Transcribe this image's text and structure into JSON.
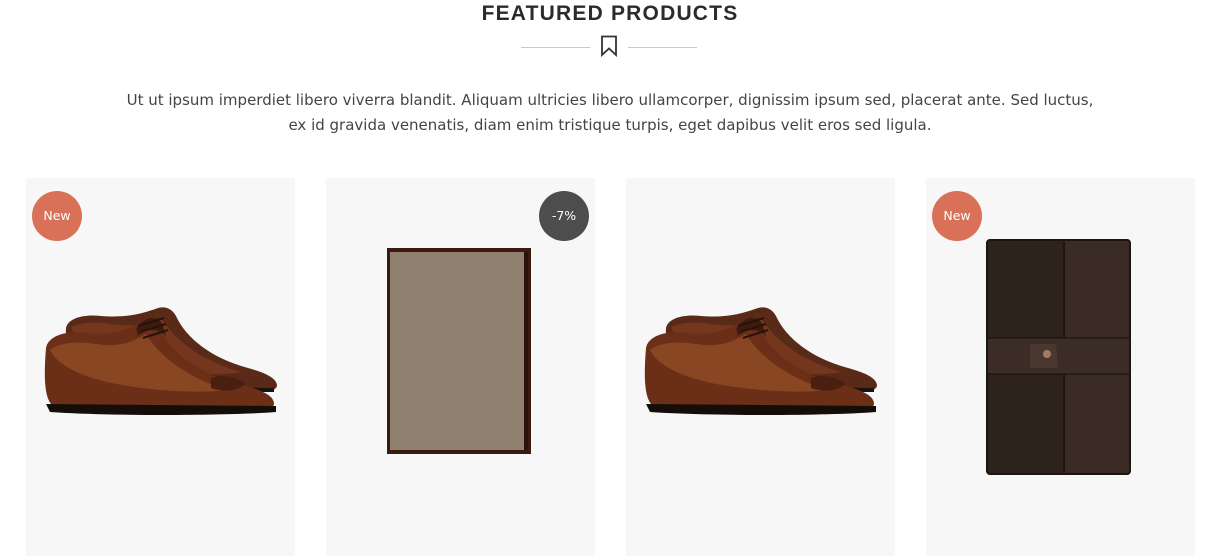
{
  "section": {
    "title": "FEATURED PRODUCTS",
    "description_line1": "Ut ut ipsum imperdiet libero viverra blandit. Aliquam ultricies libero ullamcorper, dignissim ipsum sed, placerat ante. Sed luctus,",
    "description_line2": "ex id gravida venenatis, diam enim tristique turpis, eget dapibus velit eros sed ligula.",
    "divider_icon": "bookmark-icon"
  },
  "products": [
    {
      "image": "brown-leather-oxford-shoes",
      "badge": "New",
      "badge_type": "new"
    },
    {
      "image": "brown-card-holder",
      "badge": "-7%",
      "badge_type": "sale"
    },
    {
      "image": "brown-leather-oxford-shoes",
      "badge": "",
      "badge_type": ""
    },
    {
      "image": "dark-leather-wallet",
      "badge": "New",
      "badge_type": "new"
    }
  ],
  "colors": {
    "badge_new": "#d97058",
    "badge_sale": "#4d4d4d",
    "card_background": "#f7f7f7",
    "title": "#2b2b2b",
    "divider": "#c9c9c9"
  }
}
